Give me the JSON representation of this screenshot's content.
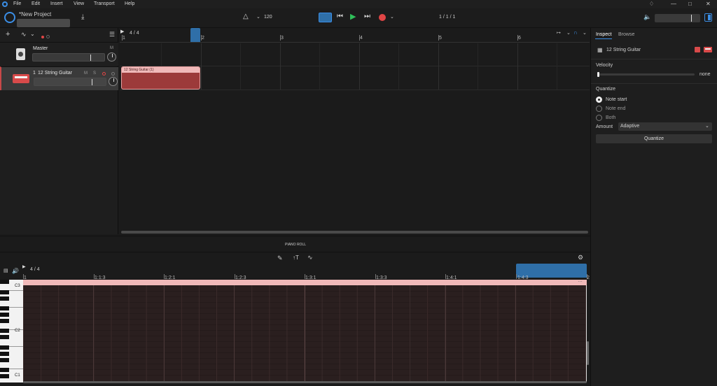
{
  "menu": [
    "File",
    "Edit",
    "Insert",
    "View",
    "Transport",
    "Help"
  ],
  "window_controls": [
    "bell-icon",
    "minimize-icon",
    "maximize-icon",
    "close-icon"
  ],
  "project": {
    "title": "*New Project",
    "name_input": ""
  },
  "transport": {
    "tempo": "120",
    "position": "1 / 1 / 1"
  },
  "arrangement": {
    "time_signature": "4 / 4",
    "bars": [
      "1",
      "2",
      "3",
      "4",
      "5",
      "6"
    ],
    "tracks": [
      {
        "name": "Master",
        "solo_mute": "M",
        "type": "master"
      },
      {
        "number": "1",
        "name": "12 String Guitar",
        "m": "M",
        "s": "S",
        "type": "instrument"
      }
    ],
    "clip": {
      "label": "12 String Guitar (1)"
    }
  },
  "inspector": {
    "tabs": [
      "Inspect",
      "Browse"
    ],
    "track_name": "12 String Guitar",
    "velocity_label": "Velocity",
    "velocity_value": "none",
    "quantize_label": "Quantize",
    "options": [
      "Note start",
      "Note end",
      "Both"
    ],
    "selected_option": "Note start",
    "amount_label": "Amount",
    "amount_value": "Adaptive",
    "quantize_button": "Quantize"
  },
  "piano_roll": {
    "title": "PIANO ROLL",
    "time_signature": "4 / 4",
    "ticks": [
      "1",
      "1:1:3",
      "1:2:1",
      "1:2:3",
      "1:3:1",
      "1:3:3",
      "1:4:1",
      "1:4:3",
      "2"
    ],
    "key_labels": [
      "C3",
      "C2",
      "C1"
    ]
  },
  "colors": {
    "accent_blue": "#2f8ad6",
    "clip_red": "#9c3a3a",
    "clip_header": "#f0b9b9",
    "play_green": "#2fbf5a",
    "record_red": "#e04545"
  }
}
